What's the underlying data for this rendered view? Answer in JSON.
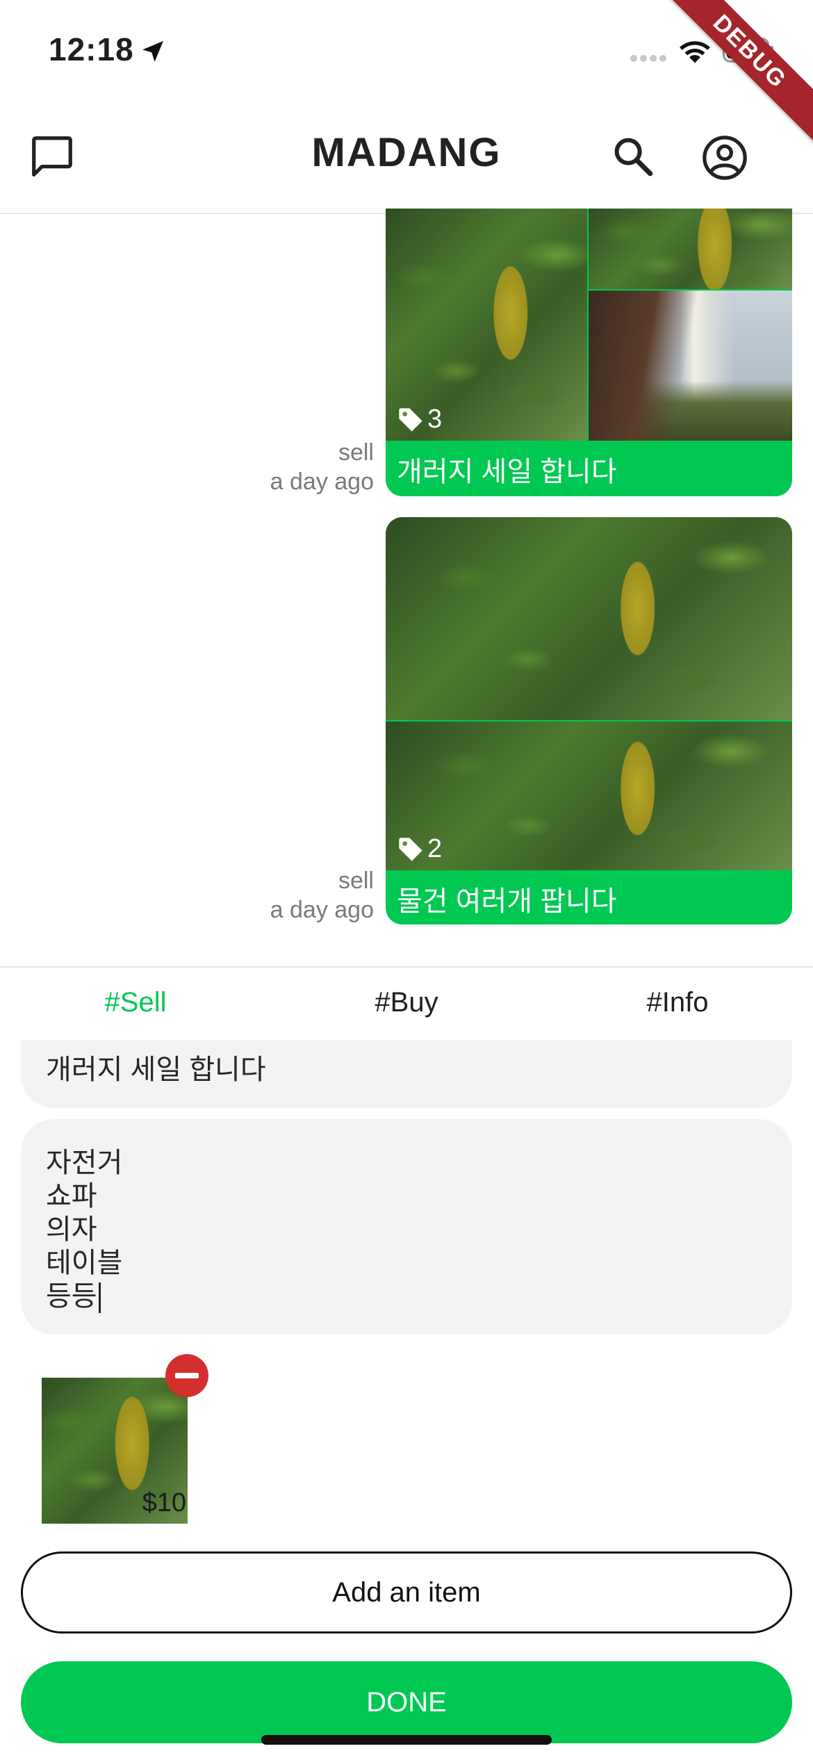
{
  "status_bar": {
    "time": "12:18",
    "icons": [
      "location-arrow-icon",
      "signal-icon",
      "wifi-icon",
      "battery-icon"
    ],
    "debug_banner": "DEBUG"
  },
  "app_bar": {
    "title": "MADANG",
    "icons": [
      "chat-icon",
      "search-icon",
      "account-icon"
    ]
  },
  "posts": [
    {
      "category": "sell",
      "time": "a day ago",
      "tag_count": "3",
      "title": "개러지 세일 합니다"
    },
    {
      "category": "sell",
      "time": "a day ago",
      "tag_count": "2",
      "title": "물건 여러개 팝니다"
    }
  ],
  "tabs": [
    {
      "label": "#Sell",
      "active": true
    },
    {
      "label": "#Buy",
      "active": false
    },
    {
      "label": "#Info",
      "active": false
    }
  ],
  "form": {
    "title_value": "개러지 세일 합니다",
    "body_lines": [
      "자전거",
      "쇼파",
      "의자",
      "테이블",
      "등등"
    ],
    "items": [
      {
        "price": "$10"
      }
    ],
    "add_item_label": "Add an item",
    "done_label": "DONE"
  },
  "colors": {
    "accent": "#00c853",
    "remove": "#d32f2f",
    "debug": "#a4262b"
  }
}
